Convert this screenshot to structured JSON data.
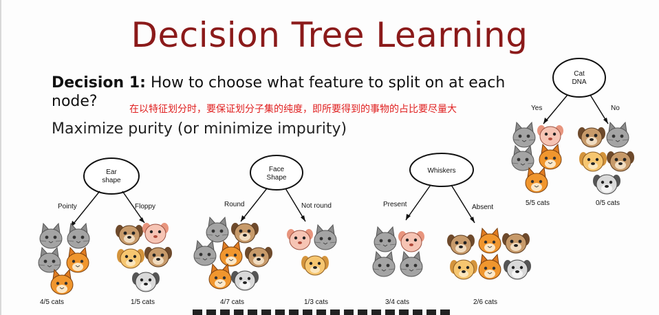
{
  "title": "Decision Tree Learning",
  "decision": {
    "label": "Decision 1:",
    "question_part1": "How to choose what feature to split on at each",
    "question_part2": "node?",
    "annotation_note": "在以特征划分时，要保证划分子集的纯度，即所要得到的事物的占比要尽量大",
    "maximize": "Maximize purity (or minimize impurity)"
  },
  "trees": [
    {
      "node": [
        "Ear",
        "shape"
      ],
      "left_branch": "Pointy",
      "right_branch": "Floppy",
      "left_result": "4/5 cats",
      "right_result": "1/5 cats"
    },
    {
      "node": [
        "Face",
        "Shape"
      ],
      "left_branch": "Round",
      "right_branch": "Not round",
      "left_result": "4/7 cats",
      "right_result": "1/3 cats"
    },
    {
      "node": [
        "Whiskers"
      ],
      "left_branch": "Present",
      "right_branch": "Absent",
      "left_result": "3/4 cats",
      "right_result": "2/6 cats"
    },
    {
      "node": [
        "Cat",
        "DNA"
      ],
      "left_branch": "Yes",
      "right_branch": "No",
      "left_result": "5/5 cats",
      "right_result": "0/5 cats"
    }
  ],
  "colors": {
    "title": "#8b1a1a",
    "note": "#e02020",
    "gray_cat": "#9a9a9a",
    "orange_cat": "#e38a2e",
    "dog_brown": "#b07a4c",
    "dog_pink": "#f2b8a8",
    "dog_tan": "#f2c270"
  }
}
